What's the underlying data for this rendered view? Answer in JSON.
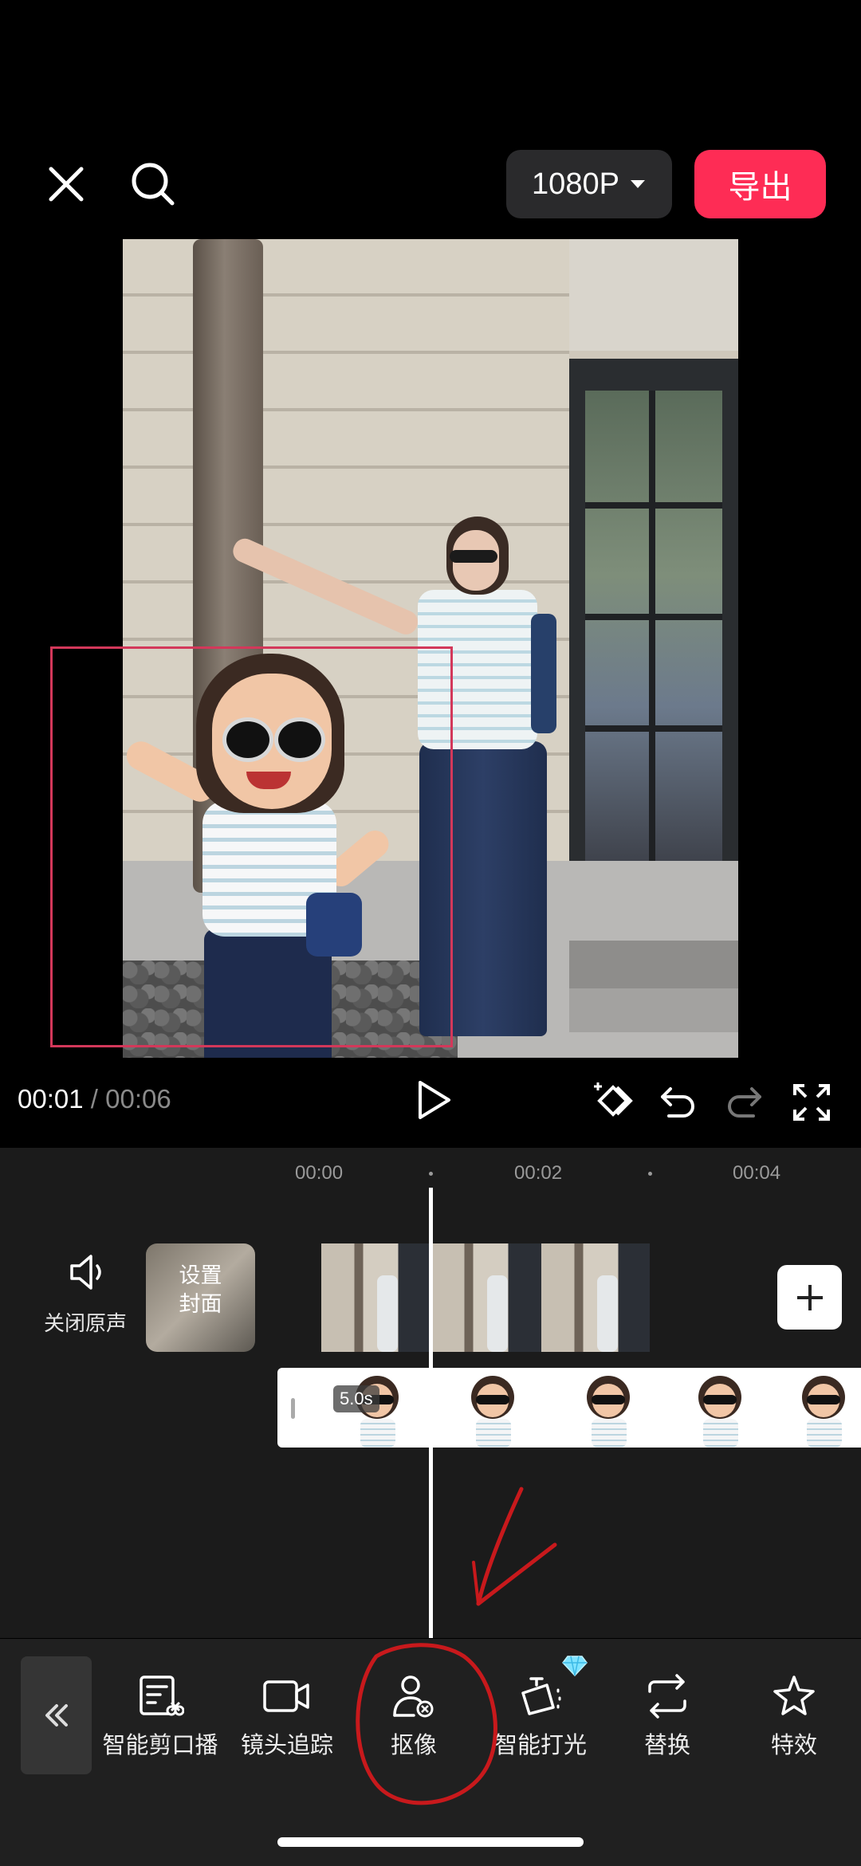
{
  "top_bar": {
    "resolution": "1080P",
    "export_label": "导出"
  },
  "player": {
    "current_time": "00:01",
    "separator": "/",
    "total_time": "00:06"
  },
  "timeline": {
    "ruler": [
      "00:00",
      "00:02",
      "00:04"
    ],
    "mute_label": "关闭原声",
    "cover_label_line1": "设置",
    "cover_label_line2": "封面",
    "sticker_duration": "5.0s"
  },
  "toolbar": {
    "items": [
      {
        "label": "智能剪口播",
        "icon": "smart-cut-icon"
      },
      {
        "label": "镜头追踪",
        "icon": "camera-track-icon"
      },
      {
        "label": "抠像",
        "icon": "cutout-person-icon"
      },
      {
        "label": "智能打光",
        "icon": "smart-light-icon"
      },
      {
        "label": "替换",
        "icon": "replace-icon"
      },
      {
        "label": "特效",
        "icon": "effects-star-icon"
      }
    ]
  },
  "colors": {
    "accent": "#fe2c55",
    "selection": "#d3385a",
    "annotation": "#c8191c"
  }
}
